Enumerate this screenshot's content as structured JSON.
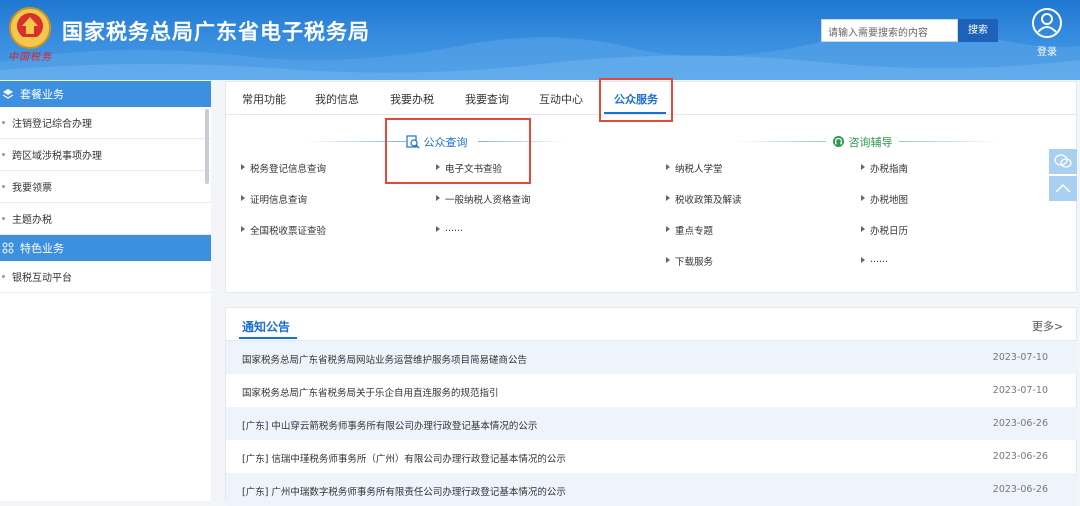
{
  "header": {
    "site_title": "国家税务总局广东省电子税务局",
    "seal_text": "中国税务",
    "search_placeholder": "请输入需要搜索的内容",
    "search_button": "搜索",
    "login_label": "登录"
  },
  "sidebar": {
    "sections": [
      {
        "title": "套餐业务",
        "icon": "layers-icon",
        "items": [
          "注销登记综合办理",
          "跨区域涉税事项办理",
          "我要领票",
          "主题办税"
        ]
      },
      {
        "title": "特色业务",
        "icon": "grid-icon",
        "items": [
          "银税互动平台"
        ]
      }
    ]
  },
  "tabs": {
    "items": [
      "常用功能",
      "我的信息",
      "我要办税",
      "我要查询",
      "互动中心",
      "公众服务"
    ],
    "active": "公众服务"
  },
  "public_query": {
    "title": "公众查询",
    "icon": "magnifier-document-icon",
    "col1": [
      "税务登记信息查询",
      "证明信息查询",
      "全国税收票证查验"
    ],
    "col2": [
      "电子文书查验",
      "一般纳税人资格查询",
      "......"
    ]
  },
  "consult": {
    "title": "咨询辅导",
    "icon": "headset-icon",
    "col1": [
      "纳税人学堂",
      "税收政策及解读",
      "重点专题",
      "下载服务"
    ],
    "col2": [
      "办税指南",
      "办税地图",
      "办税日历",
      "......"
    ]
  },
  "notices": {
    "title": "通知公告",
    "more": "更多>",
    "rows": [
      {
        "text": "国家税务总局广东省税务局网站业务运营维护服务项目简易磋商公告",
        "date": "2023-07-10"
      },
      {
        "text": "国家税务总局广东省税务局关于乐企自用直连服务的规范指引",
        "date": "2023-07-10"
      },
      {
        "text": "[广东] 中山穿云箭税务师事务所有限公司办理行政登记基本情况的公示",
        "date": "2023-06-26"
      },
      {
        "text": "[广东] 信瑞中瑾税务师事务所（广州）有限公司办理行政登记基本情况的公示",
        "date": "2023-06-26"
      },
      {
        "text": "[广东] 广州中瑞数字税务师事务所有限责任公司办理行政登记基本情况的公示",
        "date": "2023-06-26"
      }
    ]
  },
  "colors": {
    "header_blue": "#2f84d8",
    "active_blue": "#1d6fd1",
    "highlight_red": "#e04a3a",
    "consult_green": "#2c9a4b"
  }
}
